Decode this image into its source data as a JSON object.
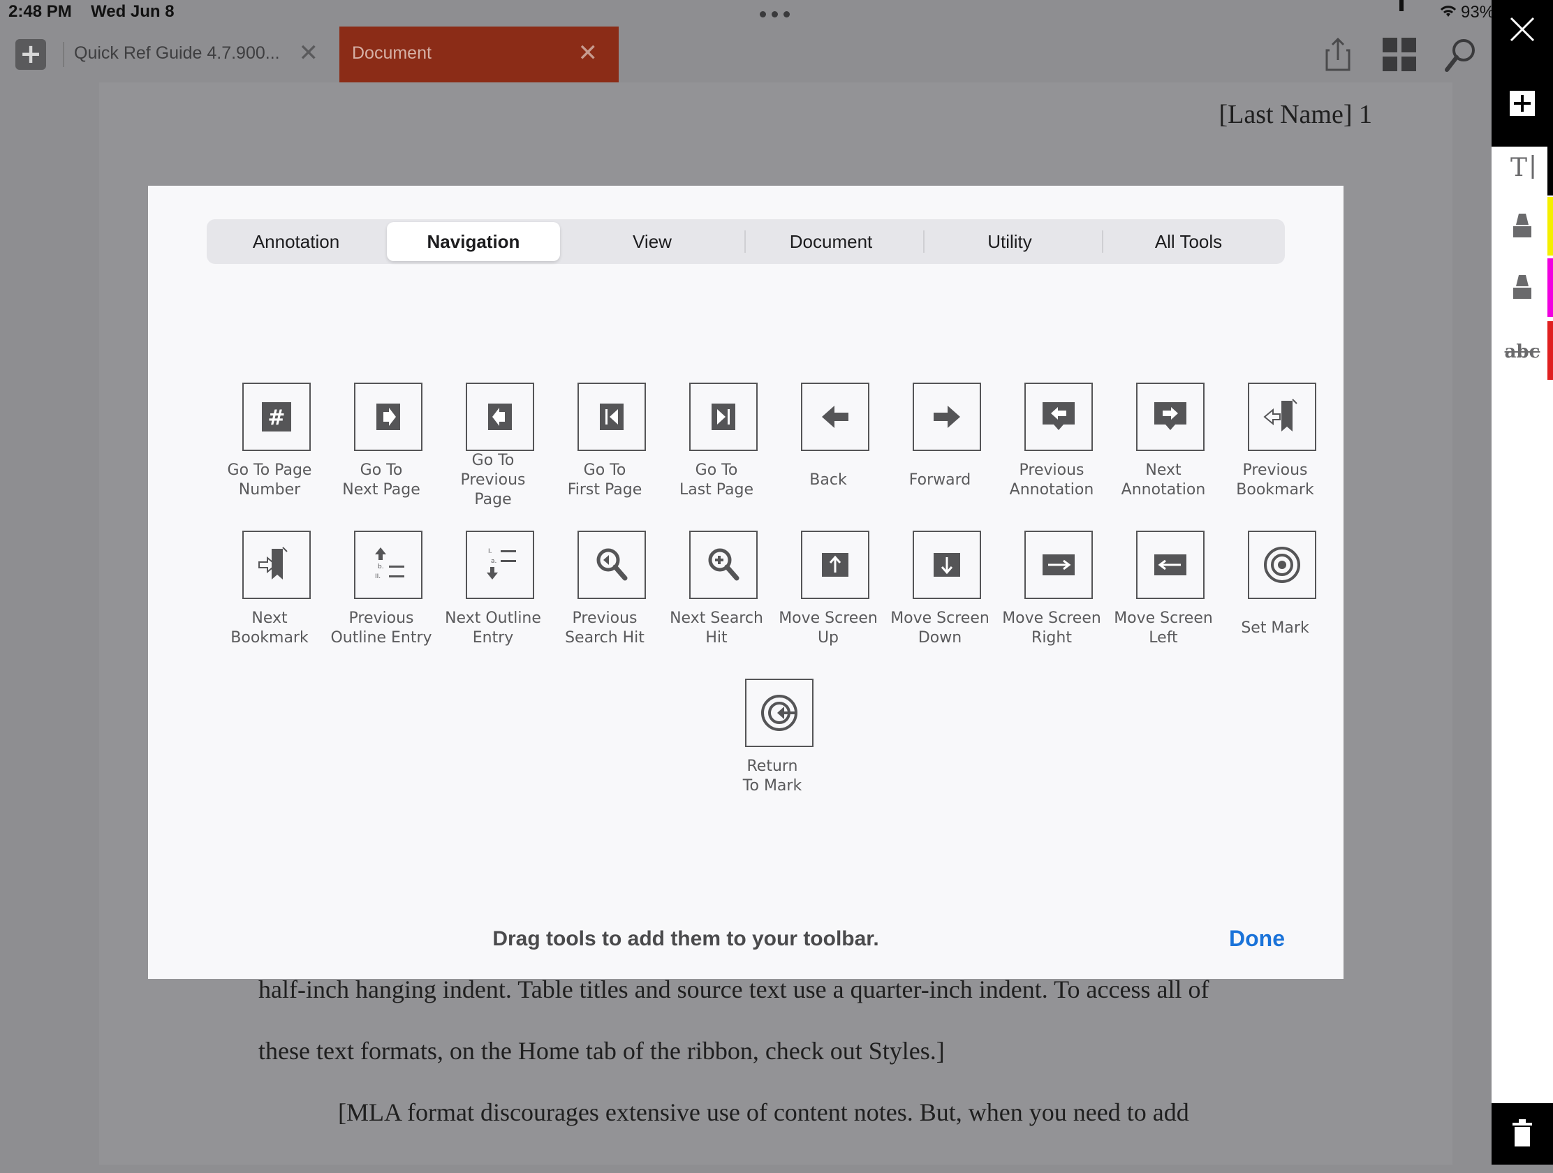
{
  "status_bar": {
    "time": "2:48 PM",
    "date": "Wed Jun 8",
    "battery": "93%"
  },
  "tabs": [
    {
      "label": "Quick Ref Guide 4.7.900...",
      "active": false
    },
    {
      "label": "Document",
      "active": true
    }
  ],
  "document": {
    "header": "[Last Name] 1",
    "lines": [
      "half-inch hanging indent. Table titles and source text use a quarter-inch indent. To access all of",
      "these text formats, on the Home tab of the ribbon, check out Styles.]",
      "[MLA format discourages extensive use of content notes. But, when you need to add"
    ]
  },
  "modal": {
    "segments": [
      {
        "label": "Annotation",
        "selected": false
      },
      {
        "label": "Navigation",
        "selected": true
      },
      {
        "label": "View",
        "selected": false
      },
      {
        "label": "Document",
        "selected": false
      },
      {
        "label": "Utility",
        "selected": false
      },
      {
        "label": "All Tools",
        "selected": false
      }
    ],
    "tools": [
      {
        "label": "Go To Page Number",
        "icon": "page-number-icon"
      },
      {
        "label": "Go To Next Page",
        "icon": "next-page-icon"
      },
      {
        "label": "Go To Previous Page",
        "icon": "previous-page-icon"
      },
      {
        "label": "Go To First Page",
        "icon": "first-page-icon"
      },
      {
        "label": "Go To Last Page",
        "icon": "last-page-icon"
      },
      {
        "label": "Back",
        "icon": "back-arrow-icon"
      },
      {
        "label": "Forward",
        "icon": "forward-arrow-icon"
      },
      {
        "label": "Previous Annotation",
        "icon": "previous-annotation-icon"
      },
      {
        "label": "Next Annotation",
        "icon": "next-annotation-icon"
      },
      {
        "label": "Previous Bookmark",
        "icon": "previous-bookmark-icon"
      },
      {
        "label": "Next Bookmark",
        "icon": "next-bookmark-icon"
      },
      {
        "label": "Previous Outline Entry",
        "icon": "previous-outline-icon"
      },
      {
        "label": "Next Outline Entry",
        "icon": "next-outline-icon"
      },
      {
        "label": "Previous Search Hit",
        "icon": "previous-search-icon"
      },
      {
        "label": "Next Search Hit",
        "icon": "next-search-icon"
      },
      {
        "label": "Move Screen Up",
        "icon": "move-up-icon"
      },
      {
        "label": "Move Screen Down",
        "icon": "move-down-icon"
      },
      {
        "label": "Move Screen Right",
        "icon": "move-right-icon"
      },
      {
        "label": "Move Screen Left",
        "icon": "move-left-icon"
      },
      {
        "label": "Set Mark",
        "icon": "target-icon"
      },
      {
        "label": "Return To Mark",
        "icon": "return-mark-icon"
      }
    ],
    "tool_label_lines": [
      [
        "Go To Page",
        "Number"
      ],
      [
        "Go To",
        "Next Page"
      ],
      [
        "Go To",
        "Previous",
        "Page"
      ],
      [
        "Go To",
        "First Page"
      ],
      [
        "Go To",
        "Last Page"
      ],
      [
        "Back"
      ],
      [
        "Forward"
      ],
      [
        "Previous",
        "Annotation"
      ],
      [
        "Next",
        "Annotation"
      ],
      [
        "Previous",
        "Bookmark"
      ],
      [
        "Next",
        "Bookmark"
      ],
      [
        "Previous",
        "Outline Entry"
      ],
      [
        "Next Outline",
        "Entry"
      ],
      [
        "Previous",
        "Search Hit"
      ],
      [
        "Next Search",
        "Hit"
      ],
      [
        "Move Screen",
        "Up"
      ],
      [
        "Move Screen",
        "Down"
      ],
      [
        "Move Screen",
        "Right"
      ],
      [
        "Move Screen",
        "Left"
      ],
      [
        "Set Mark"
      ],
      [
        "Return",
        "To Mark"
      ]
    ],
    "hint": "Drag tools to add them to your toolbar.",
    "done_label": "Done"
  },
  "right_toolbar": {
    "items": [
      {
        "icon": "add-icon"
      },
      {
        "icon": "text-tool-icon",
        "color": ""
      },
      {
        "icon": "highlighter-icon",
        "color": "#f5ef00"
      },
      {
        "icon": "highlighter-icon",
        "color": "#f000e0"
      },
      {
        "icon": "strikethrough-icon",
        "text": "abc",
        "color": "#e02020"
      }
    ]
  },
  "colors": {
    "active_tab": "#8b2c17",
    "done": "#1a73d9",
    "overlay": "#8e8e91"
  }
}
